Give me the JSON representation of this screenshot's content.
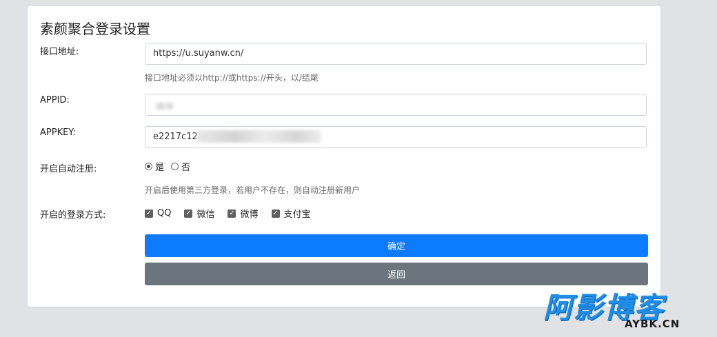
{
  "page": {
    "title": "素颜聚合登录设置"
  },
  "form": {
    "api_url": {
      "label": "接口地址:",
      "value": "https://u.suyanw.cn/",
      "help": "接口地址必须以http://或https://开头，以/结尾"
    },
    "appid": {
      "label": "APPID:",
      "value": ""
    },
    "appkey": {
      "label": "APPKEY:",
      "value": "e2217c12a"
    },
    "auto_register": {
      "label": "开启自动注册:",
      "options": [
        "是",
        "否"
      ],
      "selected": "是",
      "help": "开启后使用第三方登录，若用户不存在，则自动注册新用户"
    },
    "login_methods": {
      "label": "开启的登录方式:",
      "options": [
        {
          "label": "QQ",
          "checked": true
        },
        {
          "label": "微信",
          "checked": true
        },
        {
          "label": "微博",
          "checked": true
        },
        {
          "label": "支付宝",
          "checked": true
        }
      ]
    }
  },
  "buttons": {
    "confirm": "确定",
    "back": "返回"
  },
  "colors": {
    "primary": "#0d7bff",
    "secondary": "#6c757d",
    "background": "#e0e2e6"
  },
  "watermark": {
    "main": "阿影博客",
    "sub": "AYBK.CN"
  }
}
